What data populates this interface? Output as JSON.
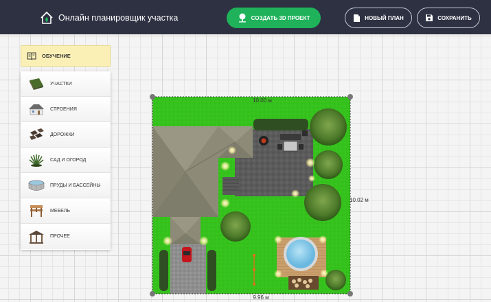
{
  "header": {
    "title": "Онлайн планировщик участка",
    "create3d_label": "СОЗДАТЬ 3D ПРОЕКТ",
    "new_plan_label": "НОВЫЙ ПЛАН",
    "save_label": "СОХРАНИТЬ"
  },
  "sidebar": {
    "tutorial_label": "ОБУЧЕНИЕ",
    "items": [
      {
        "label": "УЧАСТКИ"
      },
      {
        "label": "СТРОЕНИЯ"
      },
      {
        "label": "ДОРОЖКИ"
      },
      {
        "label": "САД И ОГОРОД"
      },
      {
        "label": "ПРУДЫ И БАССЕЙНЫ"
      },
      {
        "label": "МЕБЕЛЬ"
      },
      {
        "label": "ПРОЧЕЕ"
      }
    ]
  },
  "plot": {
    "top_dimension": "10.00 м",
    "right_dimension": "10.02 м",
    "bottom_dimension": "9.96 м"
  },
  "colors": {
    "header_bg": "#2d3142",
    "accent_green": "#1fb25a",
    "lawn": "#35c21c",
    "roof": "#8d8b78",
    "paving": "#5b5b5b",
    "water": "#8fd0ef",
    "deck": "#c9a16f"
  }
}
